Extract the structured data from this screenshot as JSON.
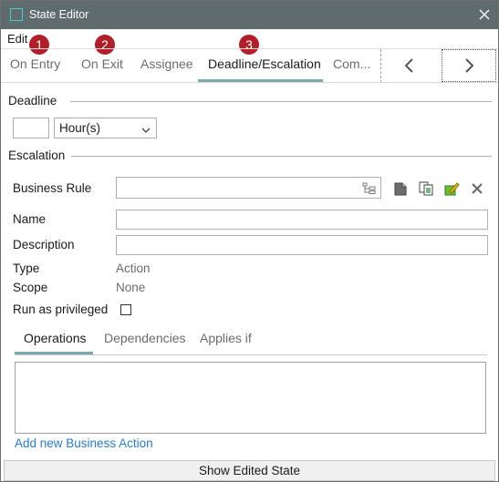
{
  "window": {
    "title": "State Editor"
  },
  "menu": {
    "edit": "Edit"
  },
  "badges": [
    "1",
    "2",
    "3"
  ],
  "tabs": [
    {
      "label": "On Entry",
      "active": false
    },
    {
      "label": "On Exit",
      "active": false
    },
    {
      "label": "Assignee",
      "active": false
    },
    {
      "label": "Deadline/Escalation",
      "active": true
    },
    {
      "label": "Com...",
      "active": false
    }
  ],
  "deadline": {
    "section_label": "Deadline",
    "value": "",
    "unit": "Hour(s)"
  },
  "escalation": {
    "section_label": "Escalation",
    "business_rule_label": "Business Rule",
    "business_rule_value": "",
    "name_label": "Name",
    "name_value": "",
    "description_label": "Description",
    "description_value": "",
    "type_label": "Type",
    "type_value": "Action",
    "scope_label": "Scope",
    "scope_value": "None",
    "privileged_label": "Run as privileged",
    "privileged_checked": false
  },
  "subtabs": [
    {
      "label": "Operations",
      "active": true
    },
    {
      "label": "Dependencies",
      "active": false
    },
    {
      "label": "Applies if",
      "active": false
    }
  ],
  "add_link": "Add new Business Action",
  "bottom_button": "Show Edited State",
  "icons": {
    "app": "window-icon",
    "close": "close-icon",
    "prev": "chevron-left-icon",
    "next": "chevron-right-icon",
    "tree": "tree-picker-icon",
    "new_rule": "new-rule-icon",
    "copy_rule": "copy-rule-icon",
    "edit_rule": "edit-rule-icon",
    "remove_rule": "remove-rule-icon"
  },
  "colors": {
    "titlebar": "#5f6b6d",
    "accent": "#7ea7ae",
    "badge": "#b1202a",
    "link": "#2b7bc0"
  }
}
